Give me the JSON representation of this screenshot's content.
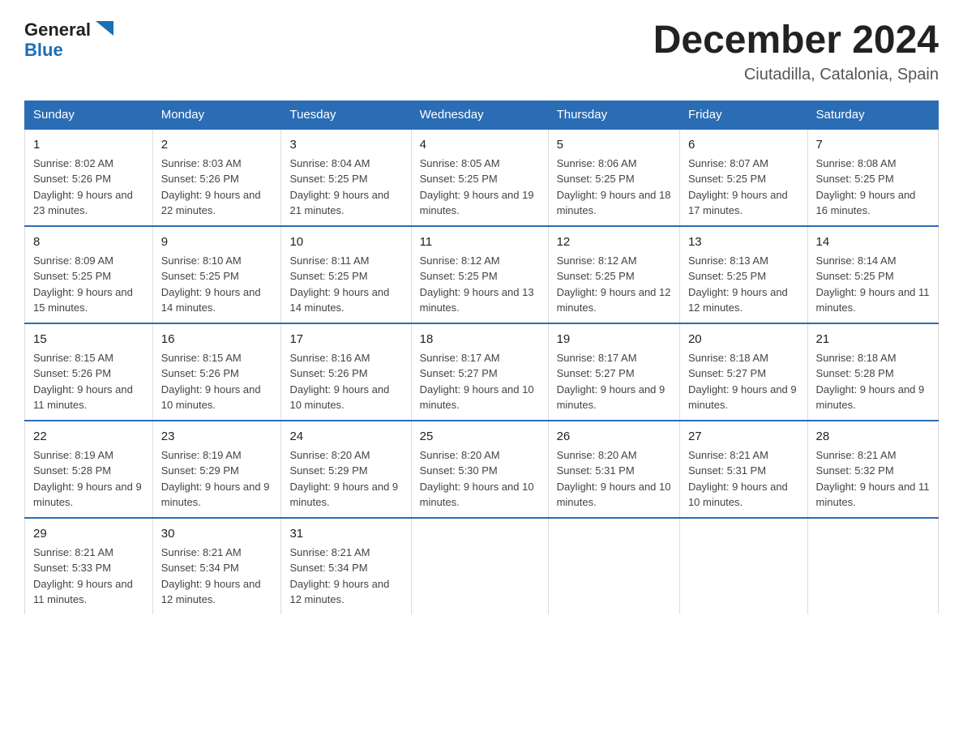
{
  "header": {
    "logo_line1": "General",
    "logo_line2": "Blue",
    "title": "December 2024",
    "subtitle": "Ciutadilla, Catalonia, Spain"
  },
  "days_of_week": [
    "Sunday",
    "Monday",
    "Tuesday",
    "Wednesday",
    "Thursday",
    "Friday",
    "Saturday"
  ],
  "weeks": [
    [
      {
        "day": "1",
        "sunrise": "8:02 AM",
        "sunset": "5:26 PM",
        "daylight": "9 hours and 23 minutes."
      },
      {
        "day": "2",
        "sunrise": "8:03 AM",
        "sunset": "5:26 PM",
        "daylight": "9 hours and 22 minutes."
      },
      {
        "day": "3",
        "sunrise": "8:04 AM",
        "sunset": "5:25 PM",
        "daylight": "9 hours and 21 minutes."
      },
      {
        "day": "4",
        "sunrise": "8:05 AM",
        "sunset": "5:25 PM",
        "daylight": "9 hours and 19 minutes."
      },
      {
        "day": "5",
        "sunrise": "8:06 AM",
        "sunset": "5:25 PM",
        "daylight": "9 hours and 18 minutes."
      },
      {
        "day": "6",
        "sunrise": "8:07 AM",
        "sunset": "5:25 PM",
        "daylight": "9 hours and 17 minutes."
      },
      {
        "day": "7",
        "sunrise": "8:08 AM",
        "sunset": "5:25 PM",
        "daylight": "9 hours and 16 minutes."
      }
    ],
    [
      {
        "day": "8",
        "sunrise": "8:09 AM",
        "sunset": "5:25 PM",
        "daylight": "9 hours and 15 minutes."
      },
      {
        "day": "9",
        "sunrise": "8:10 AM",
        "sunset": "5:25 PM",
        "daylight": "9 hours and 14 minutes."
      },
      {
        "day": "10",
        "sunrise": "8:11 AM",
        "sunset": "5:25 PM",
        "daylight": "9 hours and 14 minutes."
      },
      {
        "day": "11",
        "sunrise": "8:12 AM",
        "sunset": "5:25 PM",
        "daylight": "9 hours and 13 minutes."
      },
      {
        "day": "12",
        "sunrise": "8:12 AM",
        "sunset": "5:25 PM",
        "daylight": "9 hours and 12 minutes."
      },
      {
        "day": "13",
        "sunrise": "8:13 AM",
        "sunset": "5:25 PM",
        "daylight": "9 hours and 12 minutes."
      },
      {
        "day": "14",
        "sunrise": "8:14 AM",
        "sunset": "5:25 PM",
        "daylight": "9 hours and 11 minutes."
      }
    ],
    [
      {
        "day": "15",
        "sunrise": "8:15 AM",
        "sunset": "5:26 PM",
        "daylight": "9 hours and 11 minutes."
      },
      {
        "day": "16",
        "sunrise": "8:15 AM",
        "sunset": "5:26 PM",
        "daylight": "9 hours and 10 minutes."
      },
      {
        "day": "17",
        "sunrise": "8:16 AM",
        "sunset": "5:26 PM",
        "daylight": "9 hours and 10 minutes."
      },
      {
        "day": "18",
        "sunrise": "8:17 AM",
        "sunset": "5:27 PM",
        "daylight": "9 hours and 10 minutes."
      },
      {
        "day": "19",
        "sunrise": "8:17 AM",
        "sunset": "5:27 PM",
        "daylight": "9 hours and 9 minutes."
      },
      {
        "day": "20",
        "sunrise": "8:18 AM",
        "sunset": "5:27 PM",
        "daylight": "9 hours and 9 minutes."
      },
      {
        "day": "21",
        "sunrise": "8:18 AM",
        "sunset": "5:28 PM",
        "daylight": "9 hours and 9 minutes."
      }
    ],
    [
      {
        "day": "22",
        "sunrise": "8:19 AM",
        "sunset": "5:28 PM",
        "daylight": "9 hours and 9 minutes."
      },
      {
        "day": "23",
        "sunrise": "8:19 AM",
        "sunset": "5:29 PM",
        "daylight": "9 hours and 9 minutes."
      },
      {
        "day": "24",
        "sunrise": "8:20 AM",
        "sunset": "5:29 PM",
        "daylight": "9 hours and 9 minutes."
      },
      {
        "day": "25",
        "sunrise": "8:20 AM",
        "sunset": "5:30 PM",
        "daylight": "9 hours and 10 minutes."
      },
      {
        "day": "26",
        "sunrise": "8:20 AM",
        "sunset": "5:31 PM",
        "daylight": "9 hours and 10 minutes."
      },
      {
        "day": "27",
        "sunrise": "8:21 AM",
        "sunset": "5:31 PM",
        "daylight": "9 hours and 10 minutes."
      },
      {
        "day": "28",
        "sunrise": "8:21 AM",
        "sunset": "5:32 PM",
        "daylight": "9 hours and 11 minutes."
      }
    ],
    [
      {
        "day": "29",
        "sunrise": "8:21 AM",
        "sunset": "5:33 PM",
        "daylight": "9 hours and 11 minutes."
      },
      {
        "day": "30",
        "sunrise": "8:21 AM",
        "sunset": "5:34 PM",
        "daylight": "9 hours and 12 minutes."
      },
      {
        "day": "31",
        "sunrise": "8:21 AM",
        "sunset": "5:34 PM",
        "daylight": "9 hours and 12 minutes."
      },
      {
        "day": "",
        "sunrise": "",
        "sunset": "",
        "daylight": ""
      },
      {
        "day": "",
        "sunrise": "",
        "sunset": "",
        "daylight": ""
      },
      {
        "day": "",
        "sunrise": "",
        "sunset": "",
        "daylight": ""
      },
      {
        "day": "",
        "sunrise": "",
        "sunset": "",
        "daylight": ""
      }
    ]
  ],
  "labels": {
    "sunrise_prefix": "Sunrise: ",
    "sunset_prefix": "Sunset: ",
    "daylight_prefix": "Daylight: "
  }
}
